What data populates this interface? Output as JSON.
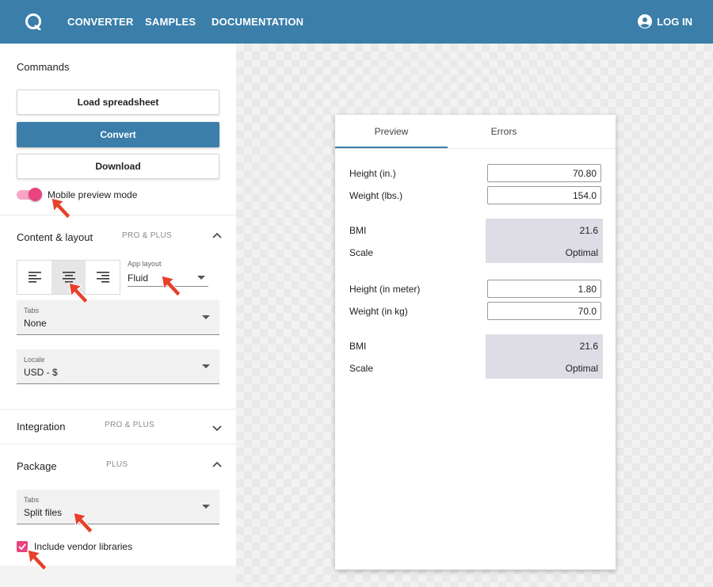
{
  "topbar": {
    "nav": [
      "CONVERTER",
      "SAMPLES",
      "DOCUMENTATION"
    ],
    "login_label": "LOG IN",
    "color": "#3a7ea9"
  },
  "sidebar": {
    "commands_title": "Commands",
    "load_label": "Load spreadsheet",
    "convert_label": "Convert",
    "download_label": "Download",
    "mobile_preview": {
      "label": "Mobile preview mode",
      "on": true
    },
    "content_layout": {
      "title": "Content & layout",
      "badge": "PRO & PLUS",
      "expanded": true,
      "alignment": [
        "align-left",
        "align-center",
        "align-right"
      ],
      "alignment_selected": "align-center",
      "app_layout": {
        "label": "App layout",
        "value": "Fluid"
      },
      "tabs": {
        "label": "Tabs",
        "value": "None"
      },
      "locale": {
        "label": "Locale",
        "value": "USD - $"
      }
    },
    "integration": {
      "title": "Integration",
      "badge": "PRO & PLUS",
      "expanded": false
    },
    "package": {
      "title": "Package",
      "badge": "PLUS",
      "expanded": true,
      "tabs": {
        "label": "Tabs",
        "value": "Split files"
      },
      "vendor": {
        "label": "Include vendor libraries",
        "checked": true
      }
    }
  },
  "preview": {
    "tabs": [
      "Preview",
      "Errors"
    ],
    "active_tab": "Preview",
    "imperial": {
      "height_label": "Height (in.)",
      "height_value": "70.80",
      "weight_label": "Weight (lbs.)",
      "weight_value": "154.0",
      "bmi_label": "BMI",
      "bmi_value": "21.6",
      "scale_label": "Scale",
      "scale_value": "Optimal"
    },
    "metric": {
      "height_label": "Height (in meter)",
      "height_value": "1.80",
      "weight_label": "Weight (in kg)",
      "weight_value": "70.0",
      "bmi_label": "BMI",
      "bmi_value": "21.6",
      "scale_label": "Scale",
      "scale_value": "Optimal"
    }
  },
  "colors": {
    "accent": "#3a7ea9",
    "pink": "#e8447f",
    "arrow": "#e8402a",
    "result_bg": "#dedde6"
  }
}
